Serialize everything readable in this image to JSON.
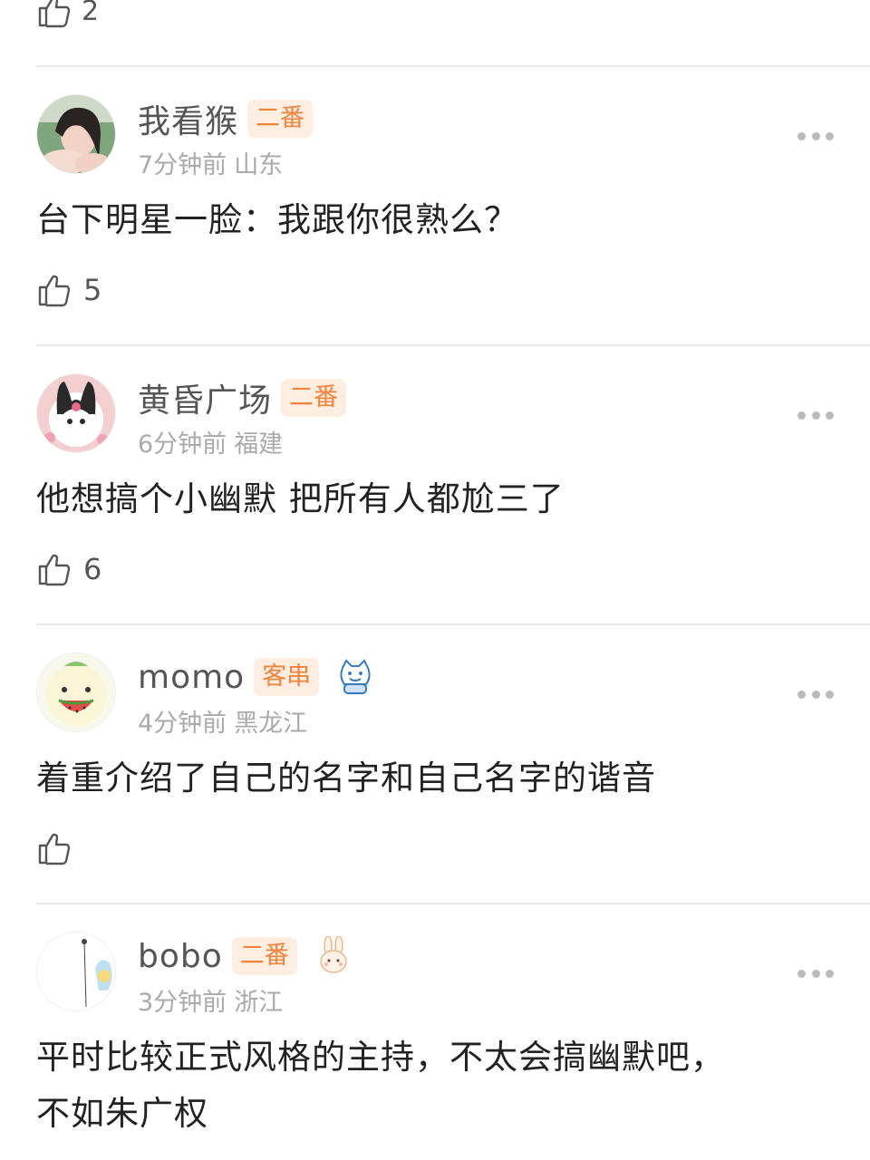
{
  "top": {
    "likes": "2"
  },
  "comments": [
    {
      "username": "我看猴",
      "badge": "二番",
      "time": "7分钟前",
      "location": "山东",
      "text": "台下明星一脸：我跟你很熟么？",
      "likes": "5",
      "emote": "",
      "avatar_icon": "girl-photo-avatar"
    },
    {
      "username": "黄昏广场",
      "badge": "二番",
      "time": "6分钟前",
      "location": "福建",
      "text": "他想搞个小幽默 把所有人都尬三了",
      "likes": "6",
      "emote": "",
      "avatar_icon": "kuromi-avatar"
    },
    {
      "username": "momo",
      "badge": "客串",
      "time": "4分钟前",
      "location": "黑龙江",
      "text": "着重介绍了自己的名字和自己名字的谐音",
      "likes": "",
      "emote": "cat-mascot-icon",
      "avatar_icon": "watermelon-face-avatar"
    },
    {
      "username": "bobo",
      "badge": "二番",
      "time": "3分钟前",
      "location": "浙江",
      "text": "平时比较正式风格的主持，不太会搞幽默吧，",
      "text2": "不如朱广权",
      "emote": "rabbit-mascot-icon",
      "avatar_icon": "sketch-avatar"
    }
  ],
  "colors": {
    "badge_bg": "#fdeee1",
    "badge_text": "#f0823a",
    "meta": "#aaaaaa"
  }
}
